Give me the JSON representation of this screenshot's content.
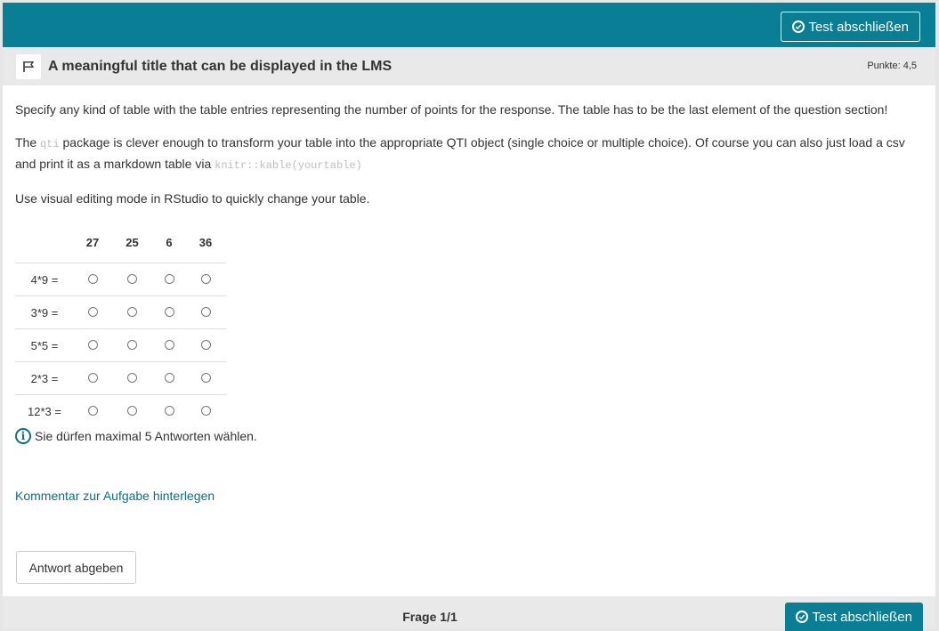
{
  "header": {
    "finish_label": "Test abschließen",
    "finish_icon": "check-circle-icon",
    "color": "#0a7e94"
  },
  "question": {
    "flag_icon": "flag-icon",
    "title": "A meaningful title that can be displayed in the LMS",
    "points": "Punkte: 4,5"
  },
  "body": {
    "p1": "Specify any kind of table with the table entries representing the number of points for the response. The table has to be the last element of the question section!",
    "p2_before": "The ",
    "p2_code": "qti",
    "p2_middle": " package is clever enough to transform your table into the appropriate QTI object (single choice or multiple choice). Of course you can also just load a csv and print it as a markdown table via ",
    "p2_code2": "knitr::kable(yourtable)",
    "p3": "Use visual editing mode in RStudio to quickly change your table."
  },
  "matrix": {
    "columns": [
      "27",
      "25",
      "6",
      "36"
    ],
    "rows": [
      "4*9 =",
      "3*9 =",
      "5*5 =",
      "2*3 =",
      "12*3 ="
    ]
  },
  "hint": {
    "icon": "info-icon",
    "text": "Sie dürfen maximal 5 Antworten wählen."
  },
  "comment_link": "Kommentar zur Aufgabe hinterlegen",
  "submit_label": "Antwort abgeben",
  "footer": {
    "page_label": "Frage 1/1",
    "finish_label": "Test abschließen"
  }
}
